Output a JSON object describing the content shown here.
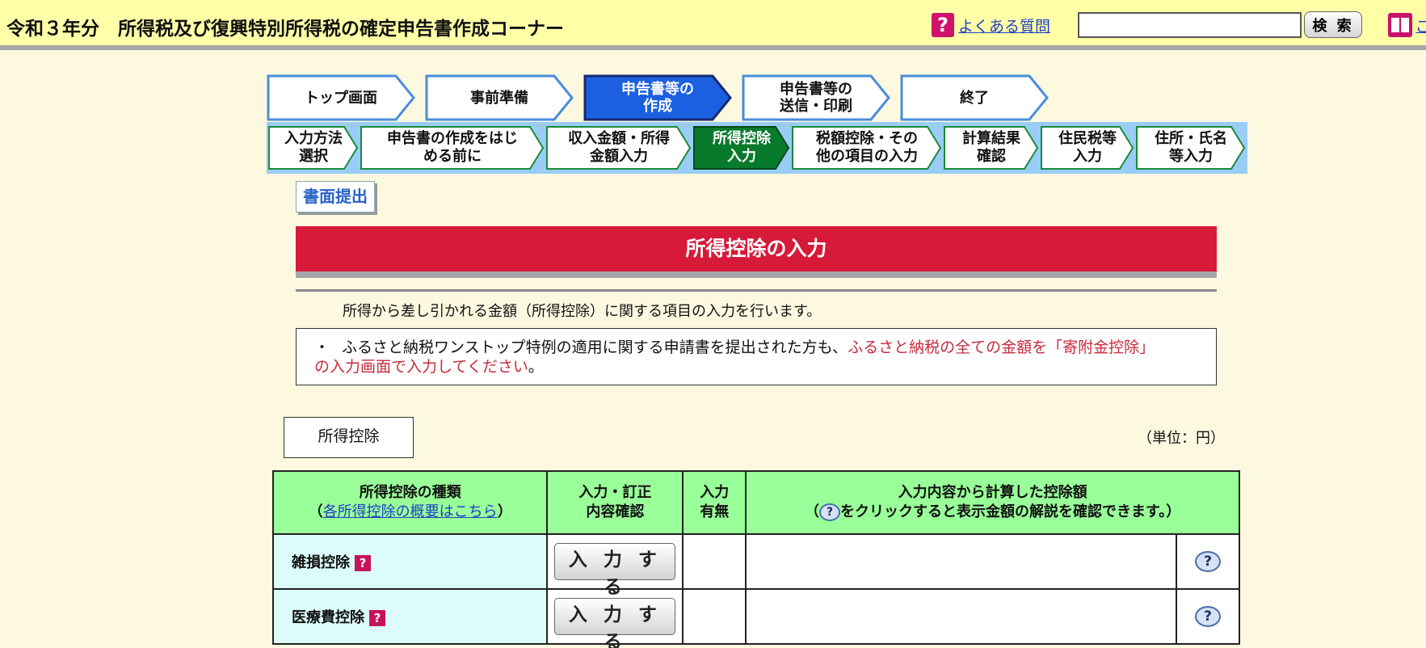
{
  "header": {
    "title": "令和３年分　所得税及び復興特別所得税の確定申告書作成コーナー",
    "faq_icon": "?",
    "faq_link": "よくある質問",
    "search_placeholder": "",
    "search_button": "検 索",
    "book_link": "ご"
  },
  "steps": [
    {
      "label": "トップ画面"
    },
    {
      "label": "事前準備"
    },
    {
      "label": "申告書等の\n作成"
    },
    {
      "label": "申告書等の\n送信・印刷"
    },
    {
      "label": "終了"
    }
  ],
  "substeps": [
    {
      "label": "入力方法\n選択"
    },
    {
      "label": "申告書の作成をはじ\nめる前に"
    },
    {
      "label": "収入金額・所得\n金額入力"
    },
    {
      "label": "所得控除\n入力"
    },
    {
      "label": "税額控除・その\n他の項目の入力"
    },
    {
      "label": "計算結果\n確認"
    },
    {
      "label": "住民税等\n入力"
    },
    {
      "label": "住所・氏名\n等入力"
    }
  ],
  "paper_button": "書面提出",
  "banner_title": "所得控除の入力",
  "intro_text": "所得から差し引かれる金額（所得控除）に関する項目の入力を行います。",
  "notice": {
    "bullet": "・",
    "text_before": "ふるさと納税ワンストップ特例の適用に関する申請書を提出された方も、",
    "text_red_1": "ふるさと納税の全ての金額を「寄附金控除」",
    "text_red_2": "の入力画面で入力してください",
    "text_after": "。"
  },
  "section_tab": "所得控除",
  "unit_label": "（単位：円）",
  "table": {
    "col1_line1": "所得控除の種類",
    "col1_open": "（",
    "col1_link": "各所得控除の概要はこちら",
    "col1_close": "）",
    "col2": "入力・訂正\n内容確認",
    "col3": "入力\n有無",
    "col4_line1": "入力内容から計算した控除額",
    "col4_open": "（",
    "col4_rest": "をクリックすると表示金額の解説を確認できます。）",
    "rows": [
      {
        "name": "雑損控除",
        "button": "入 力 す る",
        "status": "",
        "amount": ""
      },
      {
        "name": "医療費控除",
        "button": "入 力 す る",
        "status": "",
        "amount": ""
      }
    ],
    "help_icon": "?",
    "bubble_icon": "?"
  }
}
